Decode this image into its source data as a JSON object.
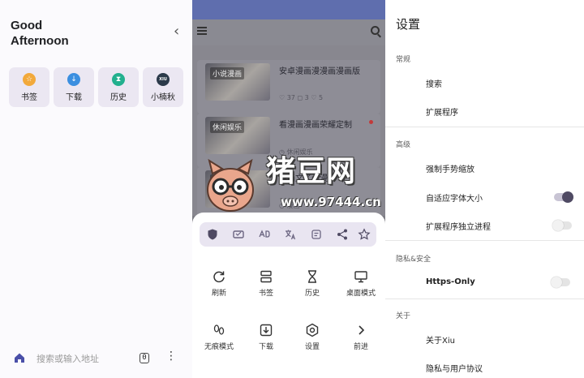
{
  "left": {
    "greeting_line1": "Good",
    "greeting_line2": "Afternoon",
    "collapse_glyph": "‹",
    "tiles": [
      {
        "label": "书签",
        "icon": "bookmark-icon",
        "color": "#f2a93b",
        "glyph": "☆"
      },
      {
        "label": "下载",
        "icon": "download-icon",
        "color": "#3b8fe0",
        "glyph": "↓"
      },
      {
        "label": "历史",
        "icon": "history-icon",
        "color": "#22b08e",
        "glyph": "⧗"
      },
      {
        "label": "小楠秋",
        "icon": "xiunan-icon",
        "color": "#2b3a4a",
        "glyph": "XIU"
      }
    ],
    "bottom": {
      "placeholder": "搜索或输入地址",
      "tab_count": "0",
      "menu_glyph": "⋮"
    }
  },
  "middle": {
    "cards": [
      {
        "tag": "小说漫画",
        "title": "安卓漫画漫漫画漫画版",
        "meta": "♡ 37  ◻ 3  ♡ 5"
      },
      {
        "tag": "休闲娱乐",
        "title": "看漫画漫画荣耀定制",
        "meta": "◷ 休闲娱乐"
      },
      {
        "tag": "休闲漫画",
        "title": "漫画文了画漫画",
        "meta": "◷ 漫画"
      }
    ],
    "menu": [
      {
        "label": "刷新",
        "icon": "refresh-icon"
      },
      {
        "label": "书签",
        "icon": "bookmarks-icon"
      },
      {
        "label": "历史",
        "icon": "hourglass-icon"
      },
      {
        "label": "桌面模式",
        "icon": "desktop-icon"
      },
      {
        "label": "无痕模式",
        "icon": "footprint-icon"
      },
      {
        "label": "下载",
        "icon": "download-tray-icon"
      },
      {
        "label": "设置",
        "icon": "settings-icon"
      },
      {
        "label": "前进",
        "icon": "forward-icon"
      }
    ],
    "watermark": {
      "text": "猪豆网",
      "url": "www.97444.cn"
    }
  },
  "right": {
    "title": "设置",
    "sections": {
      "general": "常规",
      "advanced": "高级",
      "privacy": "隐私&安全",
      "about": "关于"
    },
    "items": {
      "search": "搜索",
      "extensions": "扩展程序",
      "force_zoom": "强制手势缩放",
      "adaptive_font": "自适应字体大小",
      "ext_process": "扩展程序独立进程",
      "https_only": "Https-Only",
      "about_xiu": "关于Xiu",
      "privacy_policy": "隐私与用户协议"
    },
    "toggles": {
      "adaptive_font": true,
      "ext_process": false,
      "https_only": false
    },
    "accent_color": "#4f4a63"
  }
}
